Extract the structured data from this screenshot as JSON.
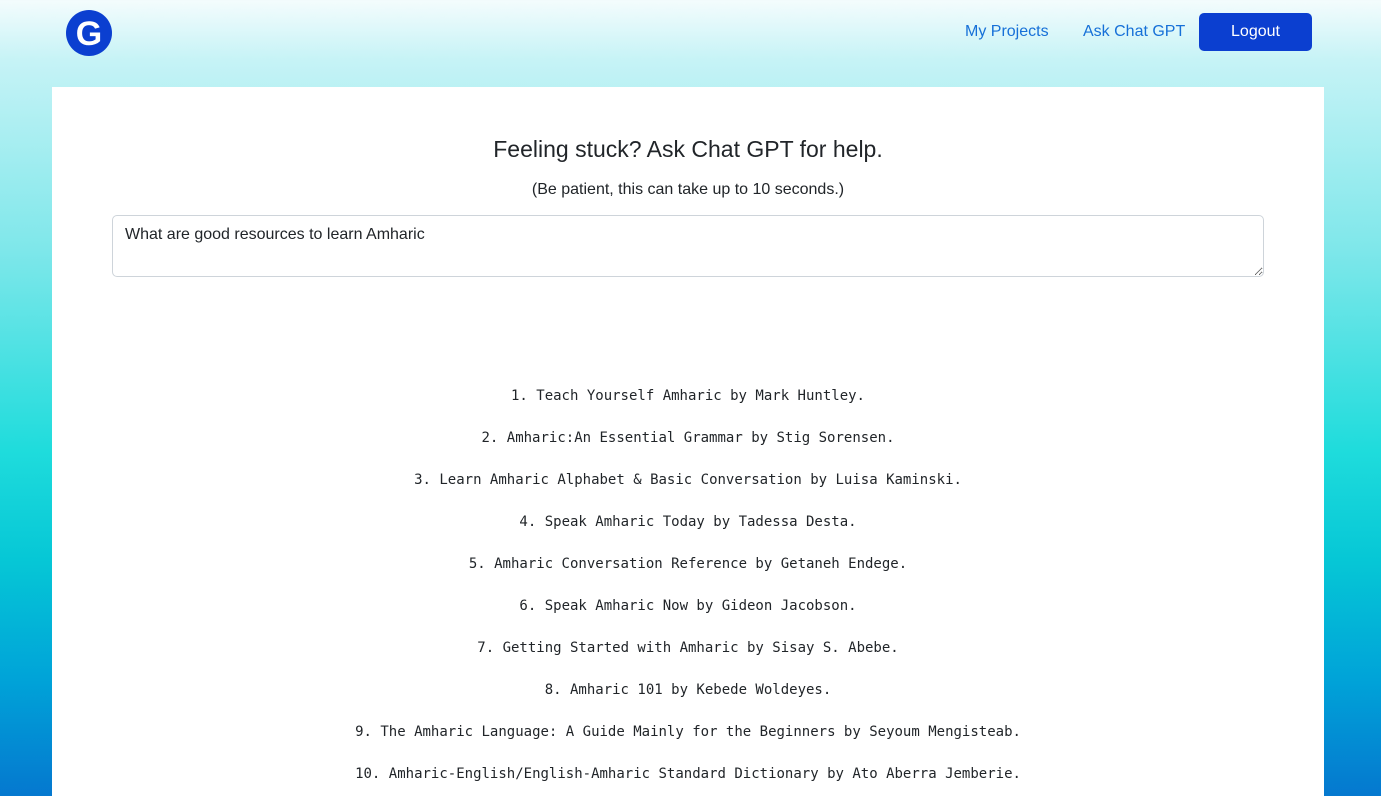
{
  "header": {
    "logo_letter": "G",
    "nav": {
      "projects": "My Projects",
      "ask_chat": "Ask Chat GPT",
      "logout": "Logout"
    },
    "colors": {
      "logo": "#0b3fd0",
      "link": "#1670d8",
      "button": "#0b3fd0"
    }
  },
  "main": {
    "title": "Feeling stuck? Ask Chat GPT for help.",
    "subtitle": "(Be patient, this can take up to 10 seconds.)",
    "prompt_value": "What are good resources to learn Amharic",
    "answer_items": [
      "1. Teach Yourself Amharic by Mark Huntley.",
      "2. Amharic:An Essential Grammar by Stig Sorensen.",
      "3. Learn Amharic Alphabet & Basic Conversation by Luisa Kaminski.",
      "4. Speak Amharic Today by Tadessa Desta.",
      "5. Amharic Conversation Reference by Getaneh Endege.",
      "6. Speak Amharic Now by Gideon Jacobson.",
      "7. Getting Started with Amharic by Sisay S. Abebe.",
      "8. Amharic 101 by Kebede Woldeyes.",
      "9. The Amharic Language: A Guide Mainly for the Beginners by Seyoum Mengisteab.",
      "10. Amharic-English/English-Amharic Standard Dictionary by Ato Aberra Jemberie."
    ]
  }
}
